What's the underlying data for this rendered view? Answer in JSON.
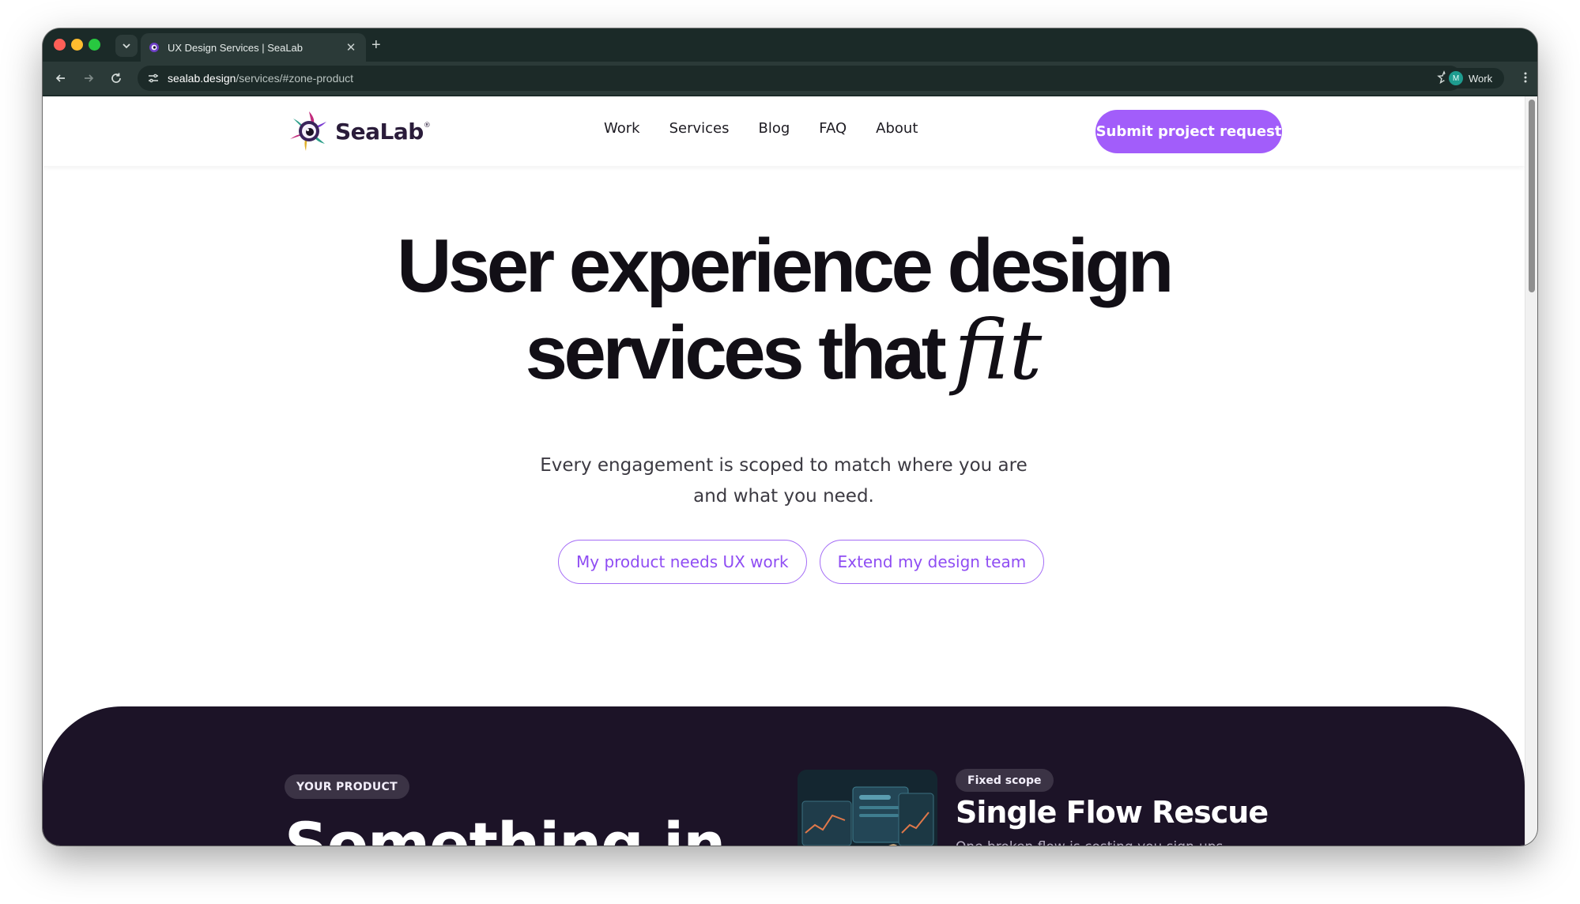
{
  "browser": {
    "tab_title": "UX Design Services | SeaLab",
    "url_host": "sealab.design",
    "url_path": "/services/#zone-product",
    "profile_initial": "M",
    "profile_label": "Work"
  },
  "header": {
    "logo_text": "SeaLab",
    "logo_mark": "®",
    "nav": [
      "Work",
      "Services",
      "Blog",
      "FAQ",
      "About"
    ],
    "cta_label": "Submit project request"
  },
  "hero": {
    "title_line1": "User experience design",
    "title_line2": "services that",
    "title_script": "fit",
    "subtitle_line1": "Every engagement is scoped to match where you are",
    "subtitle_line2": "and what you need.",
    "button_product": "My product needs UX work",
    "button_team": "Extend my design team"
  },
  "section": {
    "eyebrow": "YOUR PRODUCT",
    "heading": "Something in",
    "card": {
      "badge": "Fixed scope",
      "title": "Single Flow Rescue",
      "description": "One broken flow is costing you sign-ups, activations, or completions. We find the exact"
    }
  },
  "colors": {
    "accent": "#a25dfa",
    "dark_section": "#1c1327",
    "browser_chrome": "#1b2a28"
  }
}
